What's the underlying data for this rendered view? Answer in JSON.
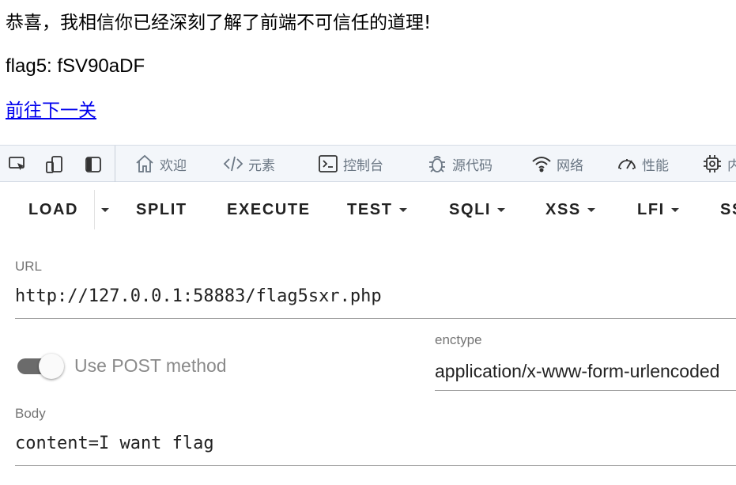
{
  "page": {
    "congrats_text": "恭喜，我相信你已经深刻了解了前端不可信任的道理!",
    "flag_text": "flag5: fSV90aDF",
    "next_link": "前往下一关"
  },
  "devtools": {
    "tabs": [
      {
        "label": "欢迎",
        "icon": "home-icon"
      },
      {
        "label": "元素",
        "icon": "code-icon"
      },
      {
        "label": "控制台",
        "icon": "console-icon"
      },
      {
        "label": "源代码",
        "icon": "bug-icon"
      },
      {
        "label": "网络",
        "icon": "wifi-icon"
      },
      {
        "label": "性能",
        "icon": "gauge-icon"
      },
      {
        "label": "内",
        "icon": "chip-icon"
      }
    ],
    "left_icons": [
      "inspect-icon",
      "device-toolbar-icon",
      "dock-side-icon"
    ]
  },
  "hackbar": {
    "buttons": [
      {
        "label": "LOAD",
        "caret": false
      },
      {
        "label": "SPLIT",
        "caret": false
      },
      {
        "label": "EXECUTE",
        "caret": false
      },
      {
        "label": "TEST",
        "caret": true
      },
      {
        "label": "SQLI",
        "caret": true
      },
      {
        "label": "XSS",
        "caret": true
      },
      {
        "label": "LFI",
        "caret": true
      },
      {
        "label": "SS",
        "caret": false
      }
    ],
    "url_label": "URL",
    "url_value": "http://127.0.0.1:58883/flag5sxr.php",
    "post_toggle_label": "Use POST method",
    "post_toggle_on": true,
    "enctype_label": "enctype",
    "enctype_value": "application/x-www-form-urlencoded",
    "body_label": "Body",
    "body_value": "content=I want flag"
  },
  "colors": {
    "link": "#0000ee",
    "devtools_bg": "#f3f6fa",
    "tab_text": "#6b7784",
    "toggle_track": "#6b6b6b"
  }
}
